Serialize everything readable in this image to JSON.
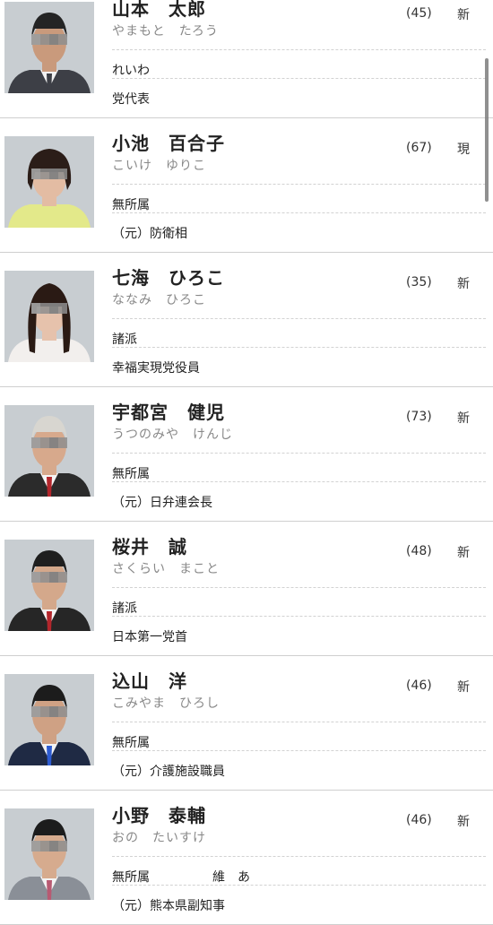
{
  "candidates": [
    {
      "name": "山本　太郎",
      "kana": "やまもと　たろう",
      "age": "(45)",
      "status": "新",
      "party": "れいわ",
      "title": "党代表",
      "photo": {
        "bg": "#c8cdd1",
        "skin": "#c99a7c",
        "hair": "#242424",
        "suit": "#3d3f46",
        "shirt": "#f2f2f2",
        "tie": "#3d3f46",
        "hair_style": "short"
      }
    },
    {
      "name": "小池　百合子",
      "kana": "こいけ　ゆりこ",
      "age": "(67)",
      "status": "現",
      "party": "無所属",
      "title": "（元）防衛相",
      "photo": {
        "bg": "#c8cdd1",
        "skin": "#e3bca3",
        "hair": "#2b1d18",
        "suit": "#e3e98a",
        "shirt": "#e3e98a",
        "tie": "#e3e98a",
        "hair_style": "bob"
      }
    },
    {
      "name": "七海　ひろこ",
      "kana": "ななみ　ひろこ",
      "age": "(35)",
      "status": "新",
      "party": "諸派",
      "title": "幸福実現党役員",
      "photo": {
        "bg": "#c8cdd1",
        "skin": "#e6c2ac",
        "hair": "#2a1a14",
        "suit": "#f2efed",
        "shirt": "#f2efed",
        "tie": "#f2efed",
        "hair_style": "long"
      }
    },
    {
      "name": "宇都宮　健児",
      "kana": "うつのみや　けんじ",
      "age": "(73)",
      "status": "新",
      "party": "無所属",
      "title": "（元）日弁連会長",
      "photo": {
        "bg": "#c8cdd1",
        "skin": "#d7a98c",
        "hair": "#d8d6d0",
        "suit": "#2b2b2b",
        "shirt": "#f5f5f5",
        "tie": "#b3262c",
        "hair_style": "short"
      }
    },
    {
      "name": "桜井　誠",
      "kana": "さくらい　まこと",
      "age": "(48)",
      "status": "新",
      "party": "諸派",
      "title": "日本第一党首",
      "photo": {
        "bg": "#c8cdd1",
        "skin": "#d4a88b",
        "hair": "#1f1f1f",
        "suit": "#262626",
        "shirt": "#f3f3f3",
        "tie": "#b3262c",
        "hair_style": "short"
      }
    },
    {
      "name": "込山　洋",
      "kana": "こみやま　ひろし",
      "age": "(46)",
      "status": "新",
      "party": "無所属",
      "title": "（元）介護施設職員",
      "photo": {
        "bg": "#c8cdd1",
        "skin": "#cfa184",
        "hair": "#1c1c1c",
        "suit": "#1f2a44",
        "shirt": "#f3f3f3",
        "tie": "#2d5bd1",
        "hair_style": "short"
      }
    },
    {
      "name": "小野　泰輔",
      "kana": "おの　たいすけ",
      "age": "(46)",
      "status": "新",
      "party": "無所属　　　　　維　あ",
      "title": "（元）熊本県副知事",
      "photo": {
        "bg": "#c8cdd1",
        "skin": "#d6ab8e",
        "hair": "#1c1c1c",
        "suit": "#8a8f97",
        "shirt": "#f3f3f3",
        "tie": "#b85a72",
        "hair_style": "short"
      }
    }
  ]
}
